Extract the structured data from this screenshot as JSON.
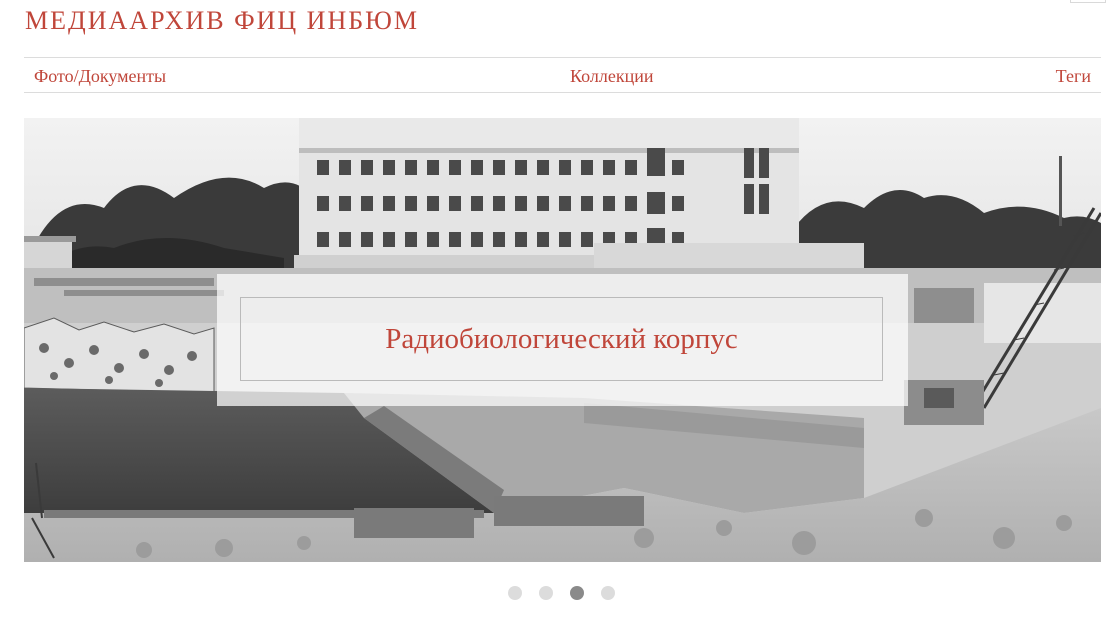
{
  "header": {
    "title": "МЕДИААРХИВ ФИЦ ИНБЮМ"
  },
  "nav": {
    "items": [
      {
        "label": "Фото/Документы"
      },
      {
        "label": "Коллекции"
      },
      {
        "label": "Теги"
      }
    ]
  },
  "slider": {
    "caption": "Радиобиологический корпус",
    "slide_count": 4,
    "active_slide": 3,
    "image_description_icon": "photo-slide-image"
  },
  "colors": {
    "accent": "#c0463a",
    "divider": "#dcdcdc",
    "dot_inactive": "#dcdcdc",
    "dot_active": "#8a8a8a"
  }
}
